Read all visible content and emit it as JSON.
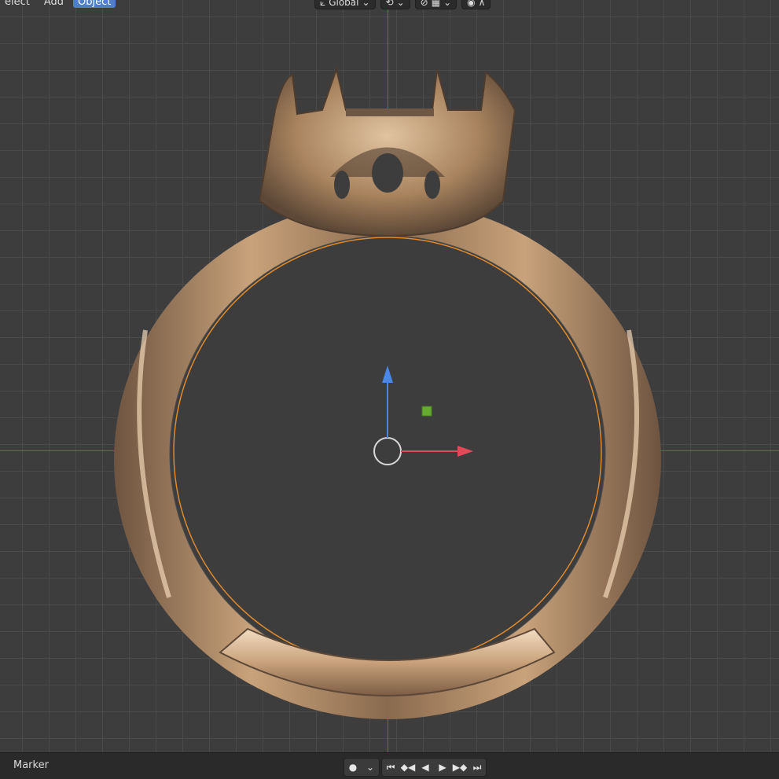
{
  "header": {
    "menu": [
      {
        "label": "elect",
        "active": false
      },
      {
        "label": "Add",
        "active": false
      },
      {
        "label": "Object",
        "active": true
      }
    ],
    "transform_orientation": "Global"
  },
  "viewport": {
    "gizmo_icons": [
      "move-gizmo-icon",
      "cursor-icon",
      "origin-icon"
    ]
  },
  "footer": {
    "marker_label": "Marker",
    "playback_icons": [
      "record-icon",
      "jump-start-icon",
      "prev-keyframe-icon",
      "play-reverse-icon",
      "play-icon",
      "next-keyframe-icon",
      "jump-end-icon"
    ]
  },
  "colors": {
    "x_axis": "#d0344a",
    "y_axis": "#3a72c6",
    "active_button": "#4f7fc8",
    "ring_metal": "#b98f62",
    "selection_outline": "#e08a2a"
  }
}
